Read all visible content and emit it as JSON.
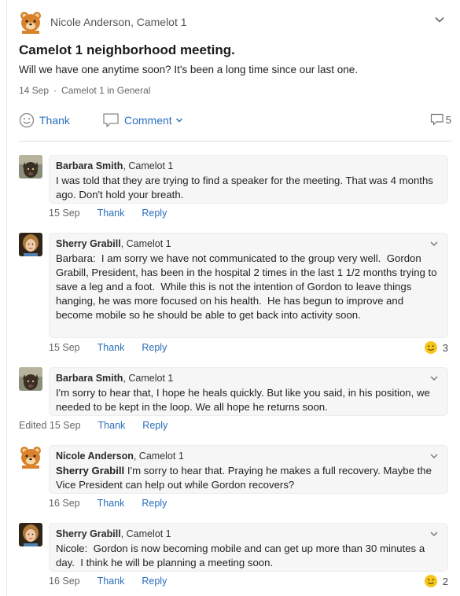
{
  "post": {
    "author": "Nicole Anderson, Camelot 1",
    "title": "Camelot 1 neighborhood meeting.",
    "body": "Will we have one anytime soon? It's been a long time since our last one.",
    "date": "14 Sep",
    "separator": "·",
    "location": "Camelot 1 in General",
    "thank_label": "Thank",
    "comment_label": "Comment",
    "reply_count": "5"
  },
  "replies": [
    {
      "name": "Barbara Smith",
      "group": ", Camelot 1",
      "mention": "",
      "text": "I was told that they are trying to find a speaker for the meeting. That was 4 months ago. Don't hold your breath.",
      "date": "15 Sep",
      "thank": "Thank",
      "reply": "Reply",
      "reaction_count": ""
    },
    {
      "name": "Sherry Grabill",
      "group": ", Camelot 1",
      "mention": "",
      "text": "Barbara:  I am sorry we have not communicated to the group very well.  Gordon Grabill, President, has been in the hospital 2 times in the last 1 1/2 months trying to save a leg and a foot.  While this is not the intention of Gordon to leave things hanging, he was more focused on his health.  He has begun to improve and become mobile so he should be able to get back into activity soon.",
      "date": "15 Sep",
      "thank": "Thank",
      "reply": "Reply",
      "reaction_count": "3"
    },
    {
      "name": "Barbara Smith",
      "group": ", Camelot 1",
      "mention": "",
      "text": "I'm sorry to hear that, I hope he heals quickly. But like you said, in his position, we needed to be kept in the loop. We all hope he returns soon.",
      "date": "Edited 15 Sep",
      "thank": "Thank",
      "reply": "Reply",
      "reaction_count": ""
    },
    {
      "name": "Nicole Anderson",
      "group": ", Camelot 1",
      "mention": "Sherry Grabill",
      "text": " I'm sorry to hear that. Praying he makes a full recovery. Maybe the Vice President can help out while Gordon recovers?",
      "date": "16 Sep",
      "thank": "Thank",
      "reply": "Reply",
      "reaction_count": ""
    },
    {
      "name": "Sherry Grabill",
      "group": ", Camelot 1",
      "mention": "",
      "text": "Nicole:  Gordon is now becoming mobile and can get up more than 30 minutes a day.  I think he will be planning a meeting soon.",
      "date": "16 Sep",
      "thank": "Thank",
      "reply": "Reply",
      "reaction_count": "2"
    }
  ],
  "colors": {
    "link": "#2a6ebb",
    "bubble": "#f6f6f6",
    "emoji": "#f5c518"
  },
  "icons": [
    "bear-avatar",
    "chevron-down-icon",
    "smiley-icon",
    "speech-bubble-icon",
    "reply-count-icon",
    "smile-reaction-icon"
  ]
}
